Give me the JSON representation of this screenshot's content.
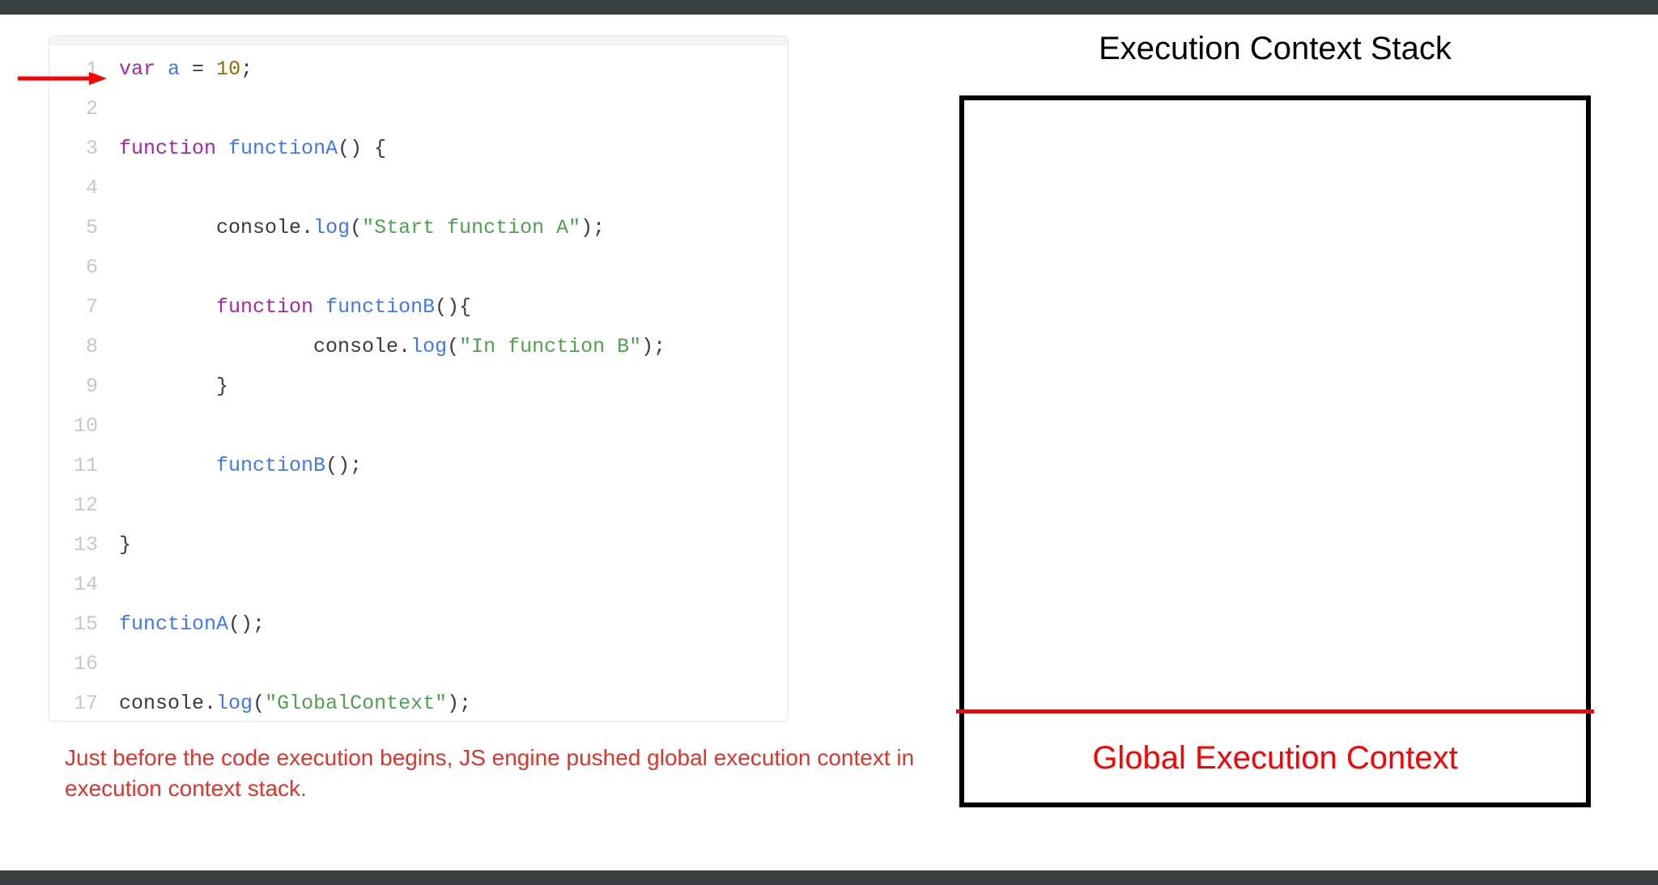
{
  "code": {
    "lines": [
      {
        "n": "1",
        "tokens": [
          [
            "kw",
            "var"
          ],
          [
            "punct",
            " "
          ],
          [
            "ident",
            "a"
          ],
          [
            "punct",
            " = "
          ],
          [
            "num",
            "10"
          ],
          [
            "punct",
            ";"
          ]
        ]
      },
      {
        "n": "2",
        "tokens": []
      },
      {
        "n": "3",
        "tokens": [
          [
            "kw",
            "function"
          ],
          [
            "punct",
            " "
          ],
          [
            "ident",
            "functionA"
          ],
          [
            "punct",
            "() {"
          ]
        ]
      },
      {
        "n": "4",
        "tokens": []
      },
      {
        "n": "5",
        "tokens": [
          [
            "punct",
            "        "
          ],
          [
            "obj",
            "console"
          ],
          [
            "punct",
            "."
          ],
          [
            "method",
            "log"
          ],
          [
            "punct",
            "("
          ],
          [
            "str",
            "\"Start function A\""
          ],
          [
            "punct",
            ");"
          ]
        ]
      },
      {
        "n": "6",
        "tokens": []
      },
      {
        "n": "7",
        "tokens": [
          [
            "punct",
            "        "
          ],
          [
            "kw",
            "function"
          ],
          [
            "punct",
            " "
          ],
          [
            "ident",
            "functionB"
          ],
          [
            "punct",
            "(){"
          ]
        ]
      },
      {
        "n": "8",
        "tokens": [
          [
            "punct",
            "                "
          ],
          [
            "obj",
            "console"
          ],
          [
            "punct",
            "."
          ],
          [
            "method",
            "log"
          ],
          [
            "punct",
            "("
          ],
          [
            "str",
            "\"In function B\""
          ],
          [
            "punct",
            ");"
          ]
        ]
      },
      {
        "n": "9",
        "tokens": [
          [
            "punct",
            "        }"
          ]
        ]
      },
      {
        "n": "10",
        "tokens": []
      },
      {
        "n": "11",
        "tokens": [
          [
            "punct",
            "        "
          ],
          [
            "ident",
            "functionB"
          ],
          [
            "punct",
            "();"
          ]
        ]
      },
      {
        "n": "12",
        "tokens": []
      },
      {
        "n": "13",
        "tokens": [
          [
            "punct",
            "}"
          ]
        ]
      },
      {
        "n": "14",
        "tokens": []
      },
      {
        "n": "15",
        "tokens": [
          [
            "ident",
            "functionA"
          ],
          [
            "punct",
            "();"
          ]
        ]
      },
      {
        "n": "16",
        "tokens": []
      },
      {
        "n": "17",
        "tokens": [
          [
            "obj",
            "console"
          ],
          [
            "punct",
            "."
          ],
          [
            "method",
            "log"
          ],
          [
            "punct",
            "("
          ],
          [
            "str",
            "\"GlobalContext\""
          ],
          [
            "punct",
            ");"
          ]
        ]
      }
    ],
    "arrow_line": 1
  },
  "caption": "Just before the code execution begins, JS engine pushed global execution context in execution context stack.",
  "stack": {
    "title": "Execution Context Stack",
    "frames_bottom_up": [
      "Global Execution Context"
    ]
  }
}
